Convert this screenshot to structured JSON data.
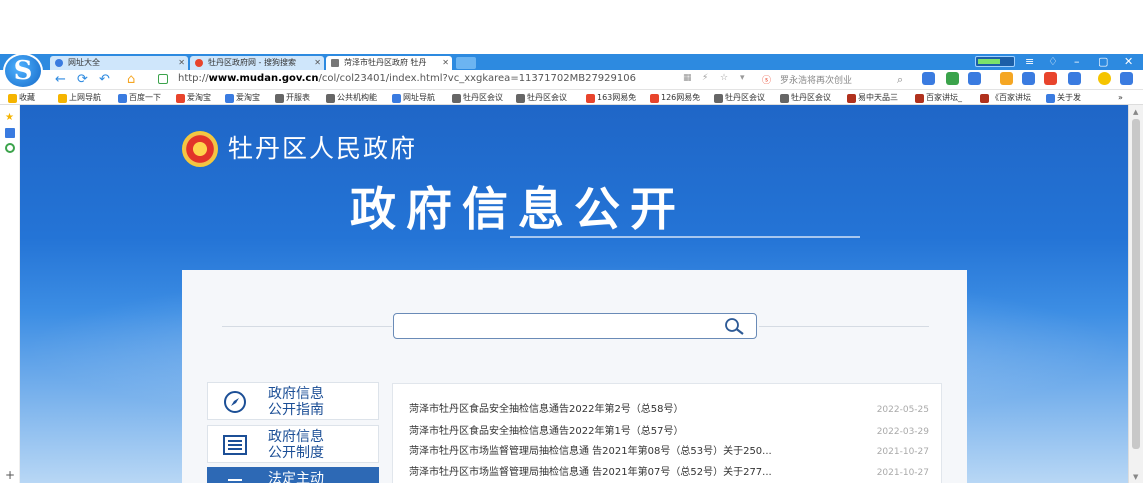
{
  "browser": {
    "tabs": [
      {
        "label": "网址大全",
        "active": false,
        "icon_color": "#3a7be0"
      },
      {
        "label": "牡丹区政府网 - 搜狗搜索",
        "active": false,
        "icon_color": "#e8442c"
      },
      {
        "label": "菏泽市牡丹区政府 牡丹",
        "active": true,
        "icon_color": "#777777"
      }
    ],
    "url_prefix": "http://",
    "url_domain": "www.mudan.gov.cn",
    "url_path": "/col/col23401/index.html?vc_xxgkarea=11371702MB27929106",
    "address_hint": "罗永浩将再次创业",
    "bookmarks": [
      {
        "label": "收藏",
        "color": "#f5b400"
      },
      {
        "label": "上网导航",
        "color": "#f5b400"
      },
      {
        "label": "百度一下",
        "color": "#3a7be0"
      },
      {
        "label": "爱淘宝",
        "color": "#e8442c"
      },
      {
        "label": "爱淘宝",
        "color": "#3a7be0"
      },
      {
        "label": "开服表",
        "color": "#666666"
      },
      {
        "label": "公共机构能",
        "color": "#666666"
      },
      {
        "label": "网址导航",
        "color": "#3a7be0"
      },
      {
        "label": "牡丹区会议",
        "color": "#666666"
      },
      {
        "label": "牡丹区会议",
        "color": "#666666"
      },
      {
        "label": "163网易免",
        "color": "#e8442c"
      },
      {
        "label": "126网易免",
        "color": "#e8442c"
      },
      {
        "label": "牡丹区会议",
        "color": "#666666"
      },
      {
        "label": "牡丹区会议",
        "color": "#666666"
      },
      {
        "label": "易中天品三",
        "color": "#b0311d"
      },
      {
        "label": "百家讲坛_",
        "color": "#b0311d"
      },
      {
        "label": "《百家讲坛",
        "color": "#b0311d"
      },
      {
        "label": "关于发",
        "color": "#3a7be0"
      }
    ]
  },
  "header": {
    "gov_name": "牡丹区人民政府",
    "title": "政府信息公开"
  },
  "search": {
    "placeholder": ""
  },
  "guide": [
    {
      "line1": "政府信息",
      "line2": "公开指南",
      "icon": "compass-icon",
      "active": false
    },
    {
      "line1": "政府信息",
      "line2": "公开制度",
      "icon": "list-icon",
      "active": false
    },
    {
      "line1": "法定主动",
      "line2": "",
      "icon": "document-icon",
      "active": true
    }
  ],
  "news": [
    {
      "title": "菏泽市牡丹区食品安全抽检信息通告2022年第2号（总58号）",
      "date": "2022-05-25"
    },
    {
      "title": "菏泽市牡丹区食品安全抽检信息通告2022年第1号（总57号）",
      "date": "2022-03-29"
    },
    {
      "title": "菏泽市牡丹区市场监督管理局抽检信息通 告2021年第08号（总53号）关于250...",
      "date": "2021-10-27"
    },
    {
      "title": "菏泽市牡丹区市场监督管理局抽检信息通 告2021年第07号（总52号）关于277...",
      "date": "2021-10-27"
    }
  ],
  "colors": {
    "page_blue": "#1f66c7",
    "panel_bg": "#f5f7fa",
    "accent_blue": "#2d69b5"
  }
}
